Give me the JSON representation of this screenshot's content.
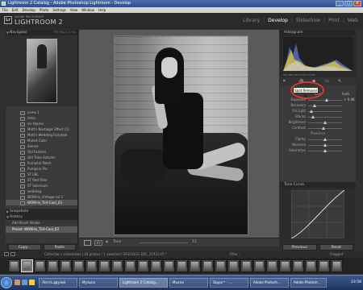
{
  "window": {
    "title": "Lightroom 2 Catalog - Adobe Photoshop Lightroom - Develop"
  },
  "menu": [
    "File",
    "Edit",
    "Develop",
    "Photo",
    "Settings",
    "View",
    "Window",
    "Help"
  ],
  "identity": {
    "sub": "ADOBE PHOTOSHOP",
    "name": "LIGHTROOM 2",
    "logo": "Lr"
  },
  "modules": [
    "Library",
    "Develop",
    "Slideshow",
    "Print",
    "Web"
  ],
  "navigator": {
    "title": "Navigator",
    "sizes": "FIT  FILL  1:1  3:1"
  },
  "presets": [
    "Lomo 1",
    "lomo",
    "sin tepmo",
    "Matt's Nostalgic Effect (1)",
    "Matt's Wedding Fairytale",
    "Muted Color",
    "Sienna",
    "Old Fashion",
    "Old Time Autumn",
    "Pumpkin Patch",
    "Pumpkin Pie",
    "ST LBL",
    "ST Red Filter",
    "ST Selenium",
    "wedding",
    "WOW-le_Vintage-col 1",
    "WOW-le_Tint-Cool_03"
  ],
  "snapshots": {
    "title": "Snapshots"
  },
  "history": {
    "title": "History",
    "items": [
      "Add Brush Stroke",
      "Preset: WOW-le_Tint-Cool_03"
    ]
  },
  "left_buttons": {
    "copy": "Copy...",
    "paste": "Paste"
  },
  "toolbar": {
    "compare": "XY",
    "label": "Tone",
    "num": "11"
  },
  "histogram": {
    "title": "Histogram",
    "info": "ISO 100  35mm  f/4.0  1/125"
  },
  "tooltip": "Spot Removal (N)",
  "basic": {
    "tone_label": "Tone",
    "auto_label": "Auto",
    "presence_label": "Presence",
    "sliders": [
      {
        "label": "Exposure",
        "pos": 0.55,
        "value": "+ 0.46"
      },
      {
        "label": "Recovery",
        "pos": 0.2,
        "value": ""
      },
      {
        "label": "Fill Light",
        "pos": 0.1,
        "value": ""
      },
      {
        "label": "Blacks",
        "pos": 0.15,
        "value": ""
      },
      {
        "label": "Brightness",
        "pos": 0.5,
        "value": ""
      },
      {
        "label": "Contrast",
        "pos": 0.45,
        "value": ""
      }
    ],
    "presence": [
      {
        "label": "Clarity",
        "pos": 0.5,
        "value": ""
      },
      {
        "label": "Vibrance",
        "pos": 0.5,
        "value": ""
      },
      {
        "label": "Saturation",
        "pos": 0.5,
        "value": ""
      }
    ]
  },
  "tone_curve": {
    "title": "Tone Curve"
  },
  "right_buttons": {
    "previous": "Previous",
    "reset": "Reset"
  },
  "filmbar": {
    "crumb": "Collection / slideshows   |   16 photos / 1 selected / 20101031-DSC_37433.tif *",
    "filter": "Filter :",
    "flagged": "Flagged"
  },
  "taskbar": {
    "tasks": [
      "Лента друзей",
      "Музыка",
      "Lightroom 2 Catalog...",
      "Мысли",
      "Skype™ - ...",
      "Adobe Photosh...",
      "Adobe Photosh..."
    ],
    "time": "23:58"
  }
}
